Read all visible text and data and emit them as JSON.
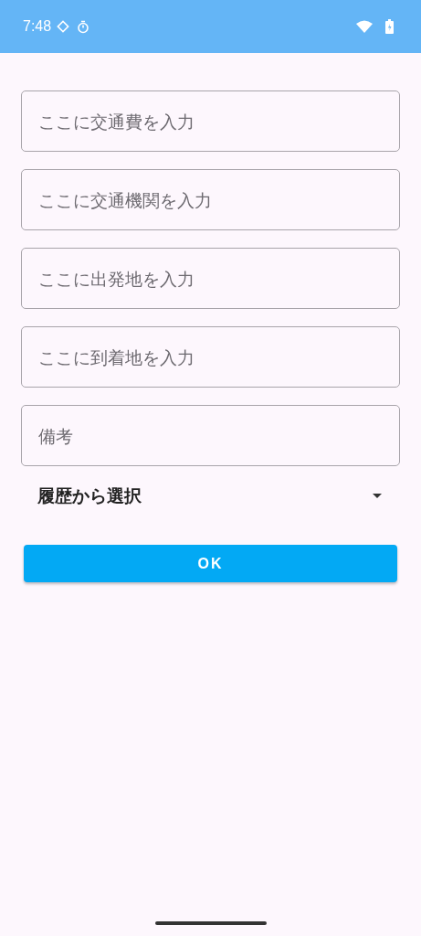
{
  "status_bar": {
    "time": "7:48"
  },
  "fields": [
    {
      "placeholder": "ここに交通費を入力"
    },
    {
      "placeholder": "ここに交通機関を入力"
    },
    {
      "placeholder": "ここに出発地を入力"
    },
    {
      "placeholder": "ここに到着地を入力"
    },
    {
      "placeholder": "備考"
    }
  ],
  "history_dropdown": {
    "value": "履歴から選択"
  },
  "ok_button": {
    "label": "OK"
  }
}
